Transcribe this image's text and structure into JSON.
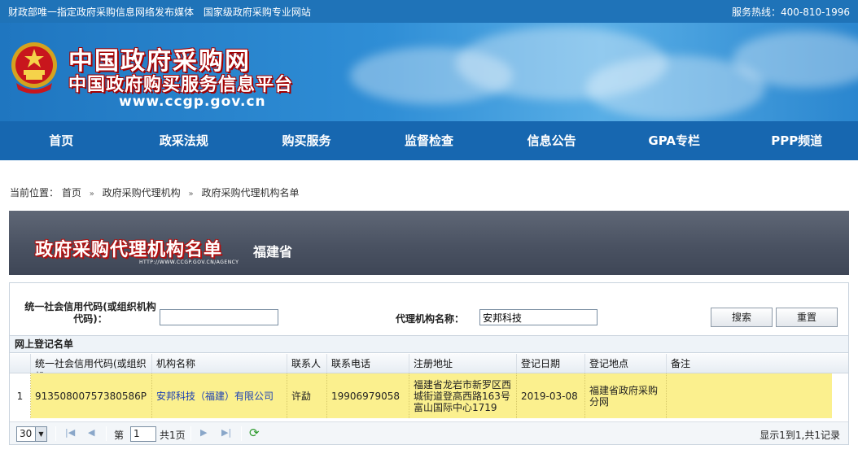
{
  "topbar": {
    "left1": "财政部唯一指定政府采购信息网络发布媒体",
    "left2": "国家级政府采购专业网站",
    "hotline": "服务热线：400-810-1996"
  },
  "banner": {
    "title": "中国政府采购网",
    "subtitle": "中国政府购买服务信息平台",
    "url": "www.ccgp.gov.cn"
  },
  "nav": [
    "首页",
    "政采法规",
    "购买服务",
    "监督检查",
    "信息公告",
    "GPA专栏",
    "PPP频道"
  ],
  "breadcrumb": {
    "prefix": "当前位置：",
    "items": [
      "首页",
      "政府采购代理机构",
      "政府采购代理机构名单"
    ]
  },
  "page_banner": {
    "title": "政府采购代理机构名单",
    "province": "福建省",
    "url_text": "HTTP://WWW.CCGP.GOV.CN/AGENCY"
  },
  "search": {
    "code_label": "统一社会信用代码(或组织机构代码)：",
    "code_value": "",
    "name_label": "代理机构名称：",
    "name_value": "安邦科技",
    "search_button": "搜索",
    "reset_button": "重置"
  },
  "grid": {
    "title": "网上登记名单",
    "columns": [
      "统一社会信用代码(或组织机",
      "机构名称",
      "联系人",
      "联系电话",
      "注册地址",
      "登记日期",
      "登记地点",
      "备注"
    ],
    "rows": [
      {
        "num": "1",
        "code": "91350800757380586P",
        "name": "安邦科技（福建）有限公司",
        "contact": "许勐",
        "phone": "19906979058",
        "address": "福建省龙岩市新罗区西城街道登高西路163号富山国际中心1719",
        "date": "2019-03-08",
        "location": "福建省政府采购分网",
        "note": ""
      }
    ]
  },
  "pager": {
    "page_size": "30",
    "page_prefix": "第",
    "page_value": "1",
    "page_suffix": "共1页",
    "info": "显示1到1,共1记录"
  }
}
